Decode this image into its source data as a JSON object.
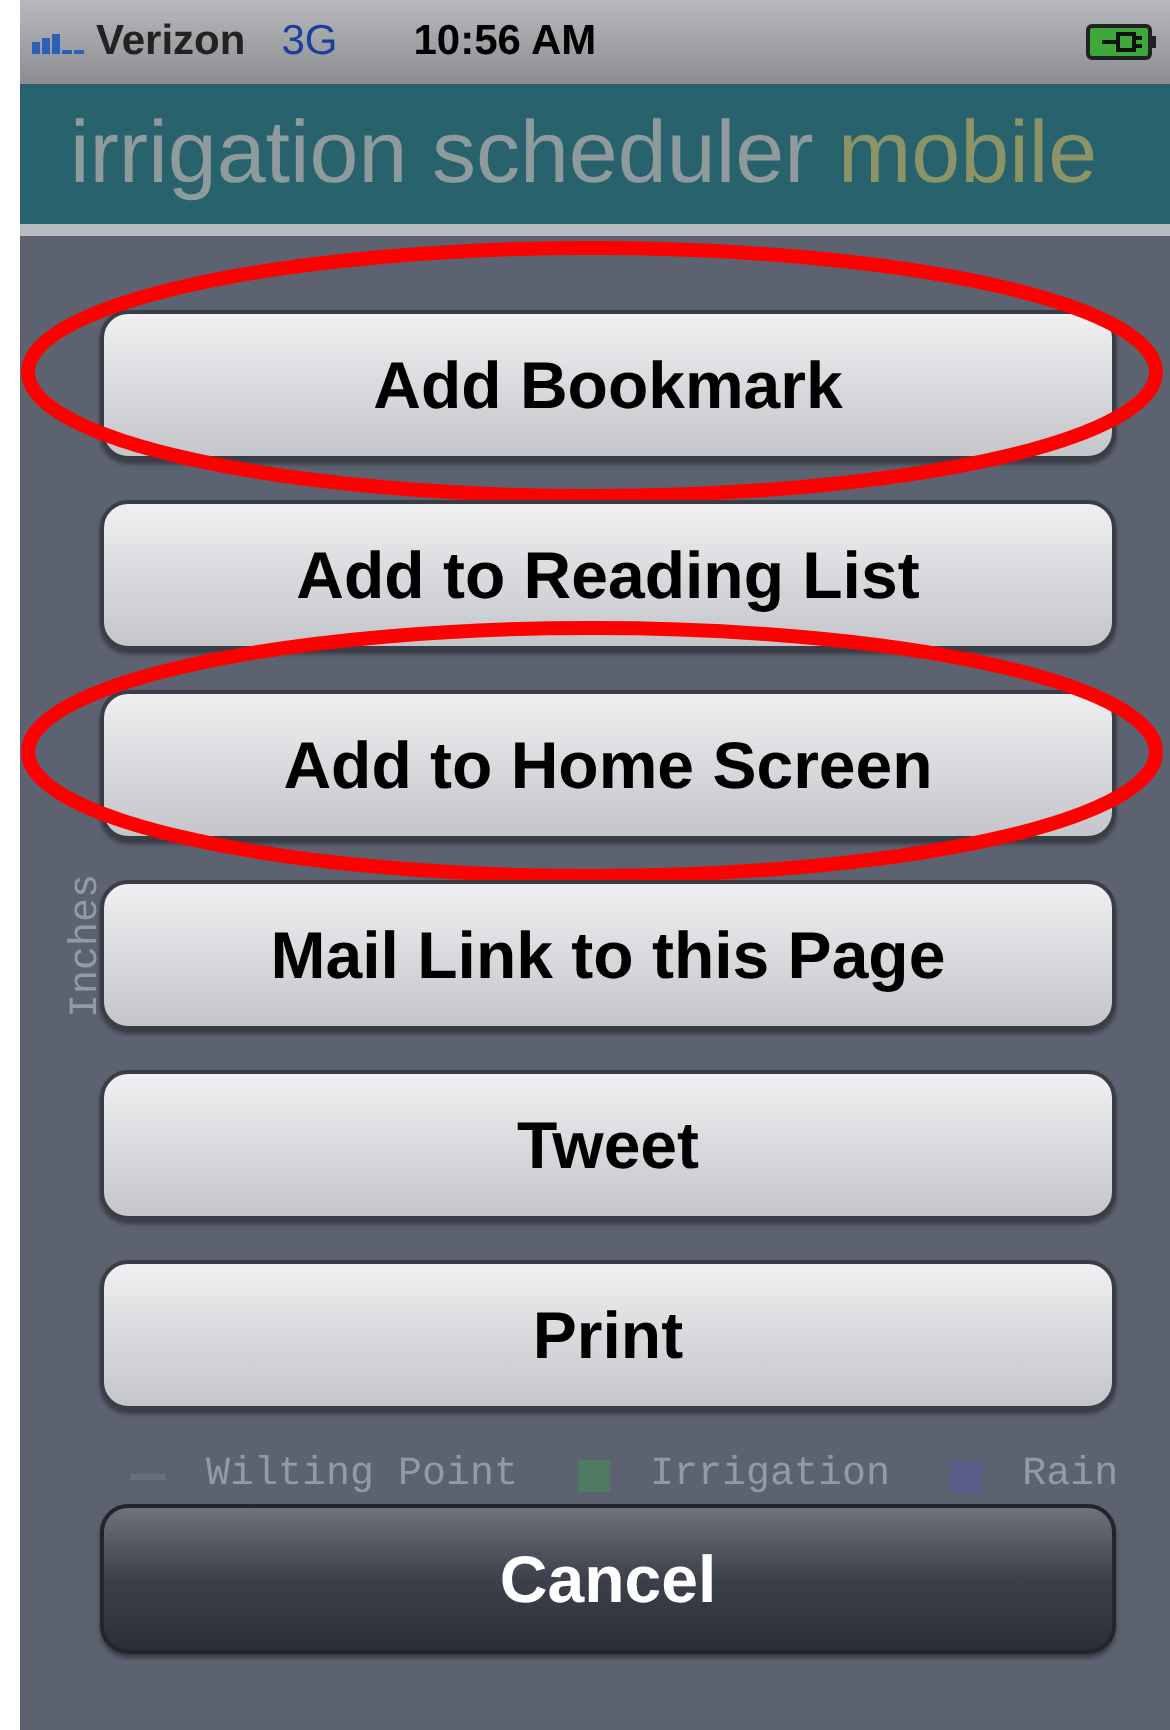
{
  "status_bar": {
    "carrier": "Verizon",
    "network": "3G",
    "time": "10:56 AM"
  },
  "header": {
    "title": "irrigation scheduler",
    "title_accent": "mobile"
  },
  "background_chart": {
    "ylabel": "Inches",
    "legend": [
      {
        "label": "Wilting Point",
        "kind": "line",
        "color": "#6a6f7c"
      },
      {
        "label": "Irrigation",
        "kind": "square",
        "color": "#4f7a62"
      },
      {
        "label": "Rain",
        "kind": "square",
        "color": "#5a5f8a"
      }
    ]
  },
  "actions": [
    {
      "label": "Add Bookmark",
      "kind": "default",
      "highlighted": true
    },
    {
      "label": "Add to Reading List",
      "kind": "default",
      "highlighted": false
    },
    {
      "label": "Add to Home Screen",
      "kind": "default",
      "highlighted": true
    },
    {
      "label": "Mail Link to this Page",
      "kind": "default",
      "highlighted": false
    },
    {
      "label": "Tweet",
      "kind": "default",
      "highlighted": false
    },
    {
      "label": "Print",
      "kind": "default",
      "highlighted": false
    },
    {
      "label": "Cancel",
      "kind": "cancel",
      "highlighted": false
    }
  ]
}
